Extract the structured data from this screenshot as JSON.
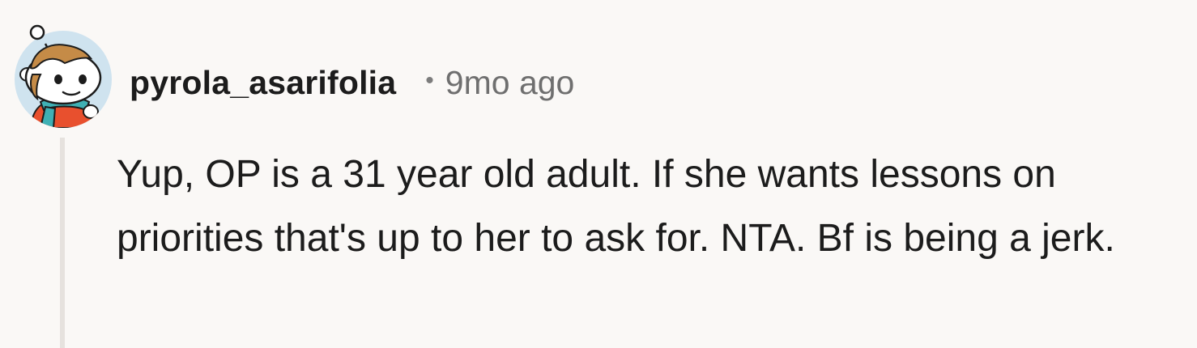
{
  "comment": {
    "author": "pyrola_asarifolia",
    "separator": "•",
    "timestamp": "9mo ago",
    "text": "Yup, OP is a 31 year old adult. If she wants lessons on priorities that's up to her to ask for. NTA. Bf is being a jerk.",
    "avatar_icon": "snoo-avatar-icon"
  },
  "colors": {
    "background": "#faf8f6",
    "thread_line": "#e6e2de",
    "text": "#1c1c1c",
    "muted": "#6f6f6f",
    "avatar_bg": "#cfe3ef",
    "shirt": "#e8502e",
    "scarf": "#3fb0b4",
    "hair": "#c58b47"
  }
}
